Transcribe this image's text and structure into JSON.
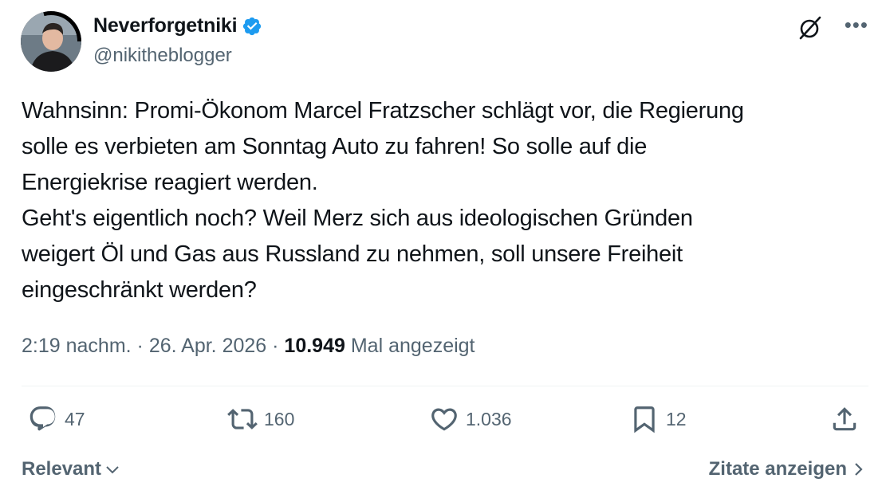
{
  "author": {
    "display_name": "Neverforgetniki",
    "handle": "@nikitheblogger",
    "verified": true
  },
  "tweet": {
    "lines": [
      "Wahnsinn: Promi-Ökonom Marcel Fratzscher schlägt vor, die Regierung",
      "solle es verbieten am Sonntag Auto zu fahren! So solle auf die",
      "Energiekrise reagiert werden.",
      "Geht's eigentlich noch? Weil Merz sich aus ideologischen Gründen",
      "weigert Öl und Gas aus Russland zu nehmen, soll unsere Freiheit",
      "eingeschränkt werden?"
    ],
    "time": "2:19 nachm.",
    "separator": "·",
    "date": "26. Apr. 2026",
    "views_count": "10.949",
    "views_label": "Mal angezeigt"
  },
  "actions": {
    "replies": "47",
    "reposts": "160",
    "likes": "1.036",
    "bookmarks": "12"
  },
  "footer": {
    "sort_label": "Relevant",
    "quotes_label": "Zitate anzeigen"
  },
  "icons": {
    "verified": "verified-badge-icon",
    "grok": "grok-icon",
    "more": "more-icon",
    "reply": "reply-icon",
    "repost": "repost-icon",
    "like": "heart-icon",
    "bookmark": "bookmark-icon",
    "share": "share-icon"
  },
  "colors": {
    "verified_blue": "#1d9bf0",
    "muted": "#536471",
    "text": "#0f1419"
  }
}
